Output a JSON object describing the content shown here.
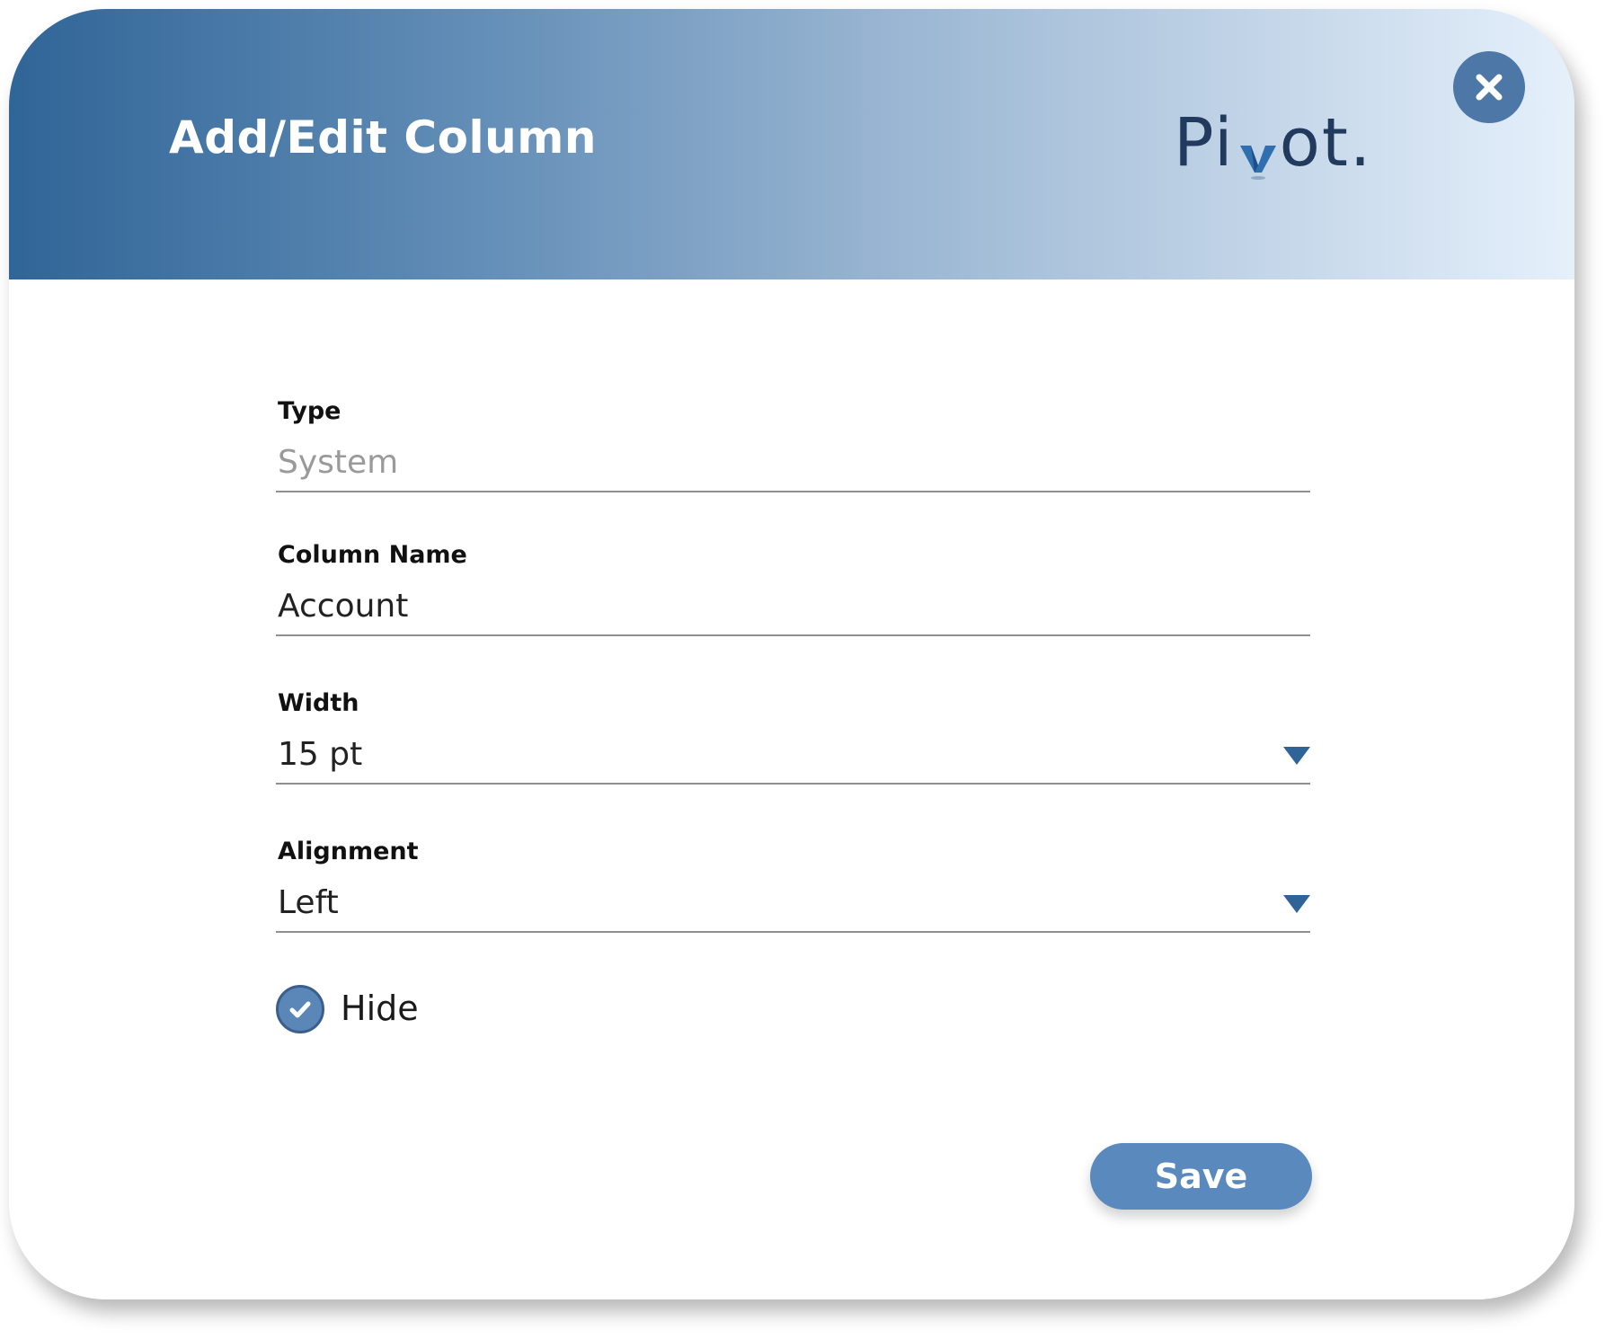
{
  "dialog": {
    "title": "Add/Edit Column",
    "logo": {
      "part1": "Pi",
      "accent_letter": "v",
      "part2": "ot."
    },
    "close_icon": "close-icon"
  },
  "form": {
    "type": {
      "label": "Type",
      "value": "System"
    },
    "column_name": {
      "label": "Column Name",
      "value": "Account"
    },
    "width": {
      "label": "Width",
      "value": "15 pt"
    },
    "alignment": {
      "label": "Alignment",
      "value": "Left"
    },
    "hide": {
      "label": "Hide",
      "checked": true
    }
  },
  "actions": {
    "save_label": "Save"
  },
  "colors": {
    "header_gradient_start": "#306597",
    "header_gradient_end": "#e5f0fb",
    "accent": "#2f6499",
    "button": "#5a8abd",
    "logo_text": "#213a5e",
    "logo_accent": "#2f6fb0"
  }
}
